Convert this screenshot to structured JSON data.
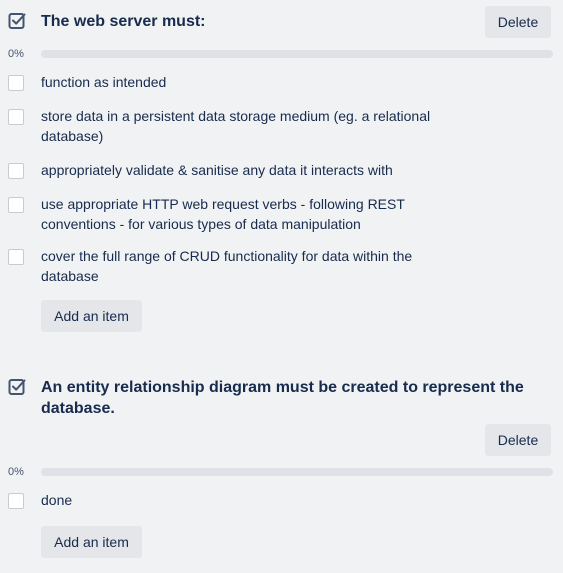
{
  "checklists": [
    {
      "title": "The web server must:",
      "delete_label": "Delete",
      "progress_text": "0%",
      "progress": 0,
      "items": [
        {
          "text": "function as intended",
          "checked": false
        },
        {
          "text": "store data in a persistent data storage medium (eg. a relational database)",
          "checked": false
        },
        {
          "text": "appropriately validate & sanitise any data it interacts with",
          "checked": false
        },
        {
          "text": "use appropriate HTTP web request verbs - following REST conventions - for various types of data manipulation",
          "checked": false
        },
        {
          "text": "cover the full range of CRUD functionality for data within the database",
          "checked": false
        }
      ],
      "add_item_label": "Add an item"
    },
    {
      "title": "An entity relationship diagram must be created to represent the database.",
      "delete_label": "Delete",
      "progress_text": "0%",
      "progress": 0,
      "items": [
        {
          "text": "done",
          "checked": false
        }
      ],
      "add_item_label": "Add an item"
    }
  ],
  "colors": {
    "background": "#f1f2f4",
    "text": "#172b4d",
    "button_bg": "#e4e6ea",
    "progress_track": "#dfe1e6",
    "progress_fill": "#1f845a"
  }
}
